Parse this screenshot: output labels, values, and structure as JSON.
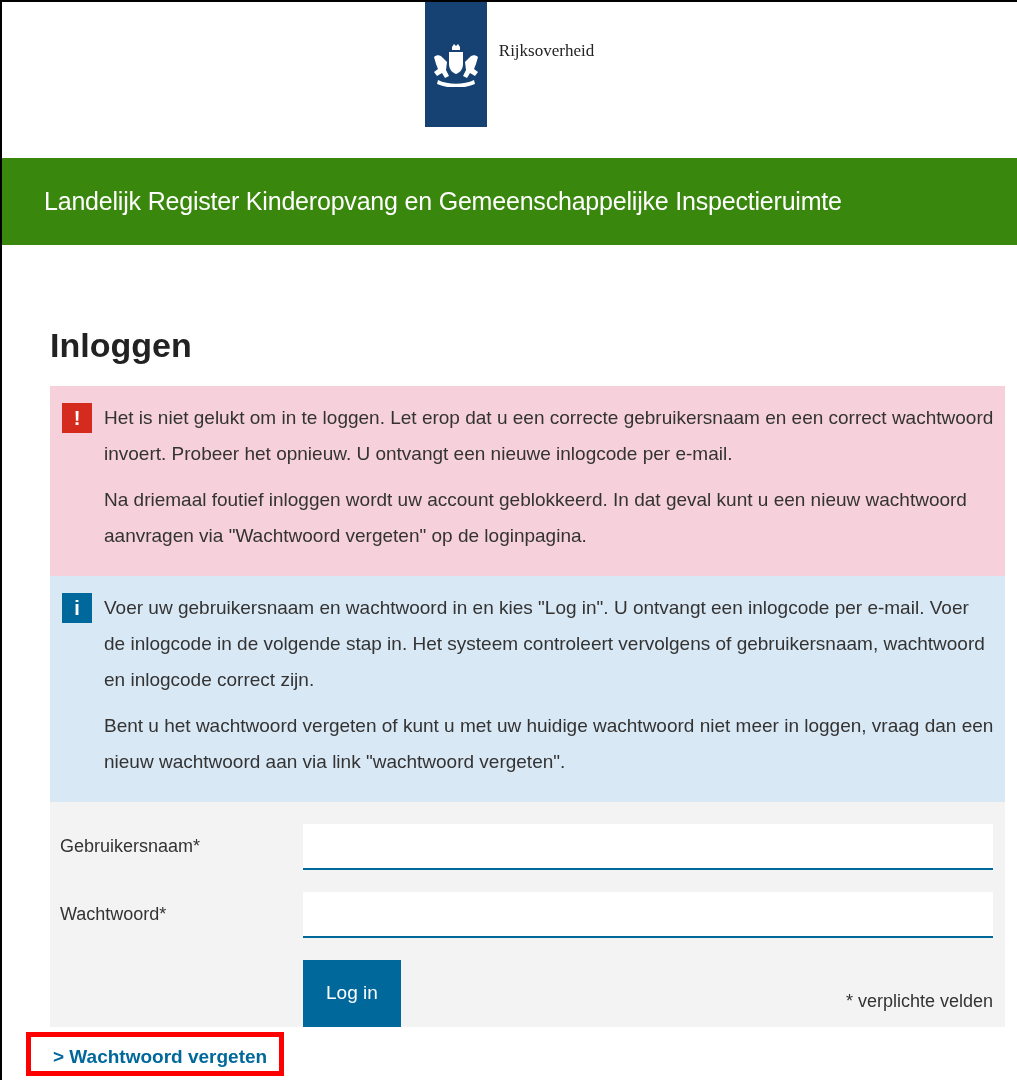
{
  "header": {
    "logo_text": "Rijksoverheid",
    "banner_title": "Landelijk Register Kinderopvang en Gemeenschappelijke Inspectieruimte"
  },
  "heading": "Inloggen",
  "messages": [
    {
      "kind": "error",
      "icon": "!",
      "paragraphs": [
        "Het is niet gelukt om in te loggen. Let erop dat u een correcte gebruikersnaam en een correct wachtwoord invoert. Probeer het opnieuw. U ontvangt een nieuwe inlogcode per e-mail.",
        "Na driemaal foutief inloggen wordt uw account geblokkeerd. In dat geval kunt u een nieuw wachtwoord aanvragen via \"Wachtwoord vergeten\" op de loginpagina."
      ]
    },
    {
      "kind": "info",
      "icon": "i",
      "paragraphs": [
        "Voer uw gebruikersnaam en wachtwoord in en kies \"Log in\". U ontvangt een inlogcode per e-mail. Voer de inlogcode in de volgende stap in. Het systeem controleert vervolgens of gebruikersnaam, wachtwoord en inlogcode correct zijn.",
        "Bent u het wachtwoord vergeten of kunt u met uw huidige wachtwoord niet meer in loggen, vraag dan een nieuw wachtwoord aan via link \"wachtwoord vergeten\"."
      ]
    }
  ],
  "form": {
    "fields": [
      {
        "label": "Gebruikersnaam*"
      },
      {
        "label": "Wachtwoord*"
      }
    ],
    "submit": "Log in",
    "required_note": "* verplichte velden"
  },
  "forgot_link": {
    "chevron": ">",
    "text": "Wachtwoord vergeten",
    "highlighted": true
  }
}
